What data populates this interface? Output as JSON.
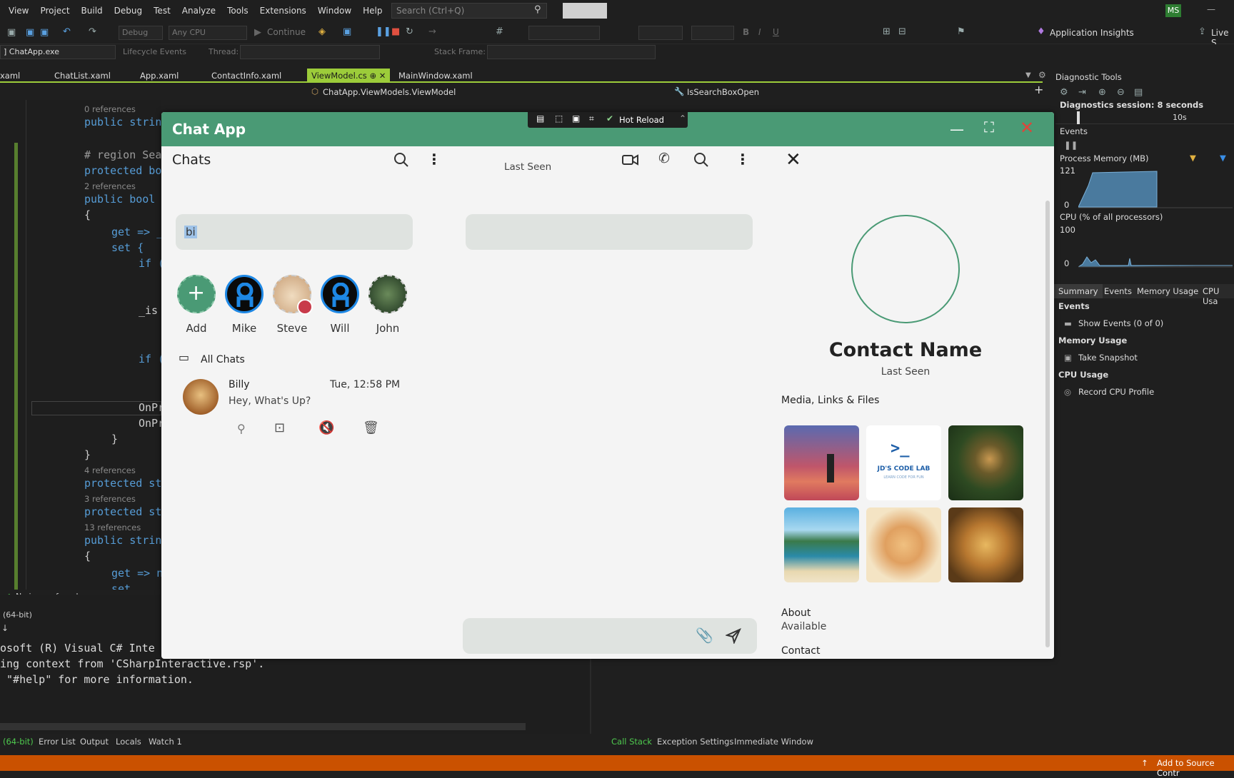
{
  "ide": {
    "menu": [
      "View",
      "Project",
      "Build",
      "Debug",
      "Test",
      "Analyze",
      "Tools",
      "Extensions",
      "Window",
      "Help"
    ],
    "search_placeholder": "Search (Ctrl+Q)",
    "user_initials": "MS",
    "config": "Debug",
    "platform": "Any CPU",
    "continue_label": "Continue",
    "app_insights": "Application Insights",
    "live_share": "Live S",
    "process": "] ChatApp.exe",
    "lifecycle": "Lifecycle Events",
    "thread": "Thread:",
    "stack_frame": "Stack Frame:",
    "tabs": [
      "xaml",
      "ChatList.xaml",
      "App.xaml",
      "ContactInfo.xaml",
      "ViewModel.cs",
      "MainWindow.xaml"
    ],
    "nav_class": "ChatApp.ViewModels.ViewModel",
    "nav_member": "IsSearchBoxOpen",
    "code": {
      "ref0": "0 references",
      "l1": "public strin",
      "l2": "# region Sea",
      "l3": "protected bo",
      "ref2": "2 references",
      "l4": "public bool",
      "l5": "{",
      "l6": "get => _",
      "l7": "set {",
      "l8": "if (",
      "l9": "_is",
      "l10": "if (",
      "l11": "OnPr",
      "l12": "OnPr",
      "l13": "}",
      "l14": "}",
      "ref4": "4 references",
      "l15": "protected st",
      "ref3": "3 references",
      "l16": "protected st",
      "ref13": "13 references",
      "l17": "public strin",
      "l18": "{",
      "l19": "get => n",
      "l20": "set"
    },
    "no_issues": "No issues found",
    "bitness": "(64-bit)",
    "console": [
      "osoft (R) Visual C# Inte",
      "ing context from 'CSharpInteractive.rsp'.",
      " \"#help\" for more information."
    ],
    "bottom_tabs_left": [
      "(64-bit)",
      "Error List",
      "Output",
      "Locals",
      "Watch 1"
    ],
    "bottom_tabs_right": [
      "Call Stack",
      "Exception Settings",
      "Immediate Window"
    ],
    "status_right": "Add to Source Contr"
  },
  "diagnostics": {
    "title": "Diagnostic Tools",
    "session": "Diagnostics session: 8 seconds",
    "timeline_label": "10s",
    "events": "Events",
    "process_memory": "Process Memory (MB)",
    "mem_max": "121",
    "mem_min": "0",
    "cpu": "CPU (% of all processors)",
    "cpu_max": "100",
    "cpu_min": "0",
    "tabs": [
      "Summary",
      "Events",
      "Memory Usage",
      "CPU Usa"
    ],
    "sec_events": "Events",
    "show_events": "Show Events (0 of 0)",
    "sec_memory": "Memory Usage",
    "take_snapshot": "Take Snapshot",
    "sec_cpu": "CPU Usage",
    "record_cpu": "Record CPU Profile"
  },
  "chat": {
    "window_title": "Chat App",
    "hot_reload": "Hot Reload",
    "chats_title": "Chats",
    "search_value": "bi",
    "status_users": [
      {
        "name": "Add",
        "color": "#4a9a75"
      },
      {
        "name": "Mike",
        "color": "#111111"
      },
      {
        "name": "Steve",
        "color": "#d8b48a"
      },
      {
        "name": "Will",
        "color": "#111111"
      },
      {
        "name": "John",
        "color": "#2f4a2e"
      }
    ],
    "all_chats": "All Chats",
    "chat_item": {
      "name": "Billy",
      "time": "Tue, 12:58 PM",
      "message": "Hey, What's Up?"
    },
    "conversation_last_seen": "Last Seen",
    "contact": {
      "name": "Contact Name",
      "last_seen": "Last Seen",
      "media_title": "Media, Links & Files",
      "about_title": "About",
      "about_value": "Available",
      "contact_title": "Contact"
    },
    "media": [
      {
        "name": "smoke-photo",
        "color": "#c0566a"
      },
      {
        "name": "jds-code-lab",
        "color": "#ffffff"
      },
      {
        "name": "leopard-photo",
        "color": "#3a5a2a"
      },
      {
        "name": "beach-photo",
        "color": "#3aa4c8"
      },
      {
        "name": "kitten-photo",
        "color": "#e8c896"
      },
      {
        "name": "lion-photo",
        "color": "#b8803a"
      }
    ],
    "logo_text": "JD'S CODE LAB",
    "logo_sub": "LEARN CODE FOR FUN",
    "accent": "#4a9a75",
    "close_red": "#e0443a"
  }
}
